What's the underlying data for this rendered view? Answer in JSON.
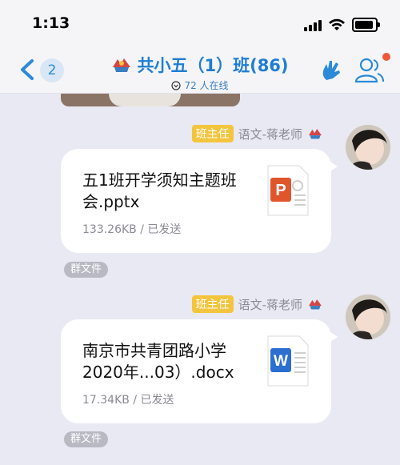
{
  "status_bar": {
    "time": "1:13"
  },
  "header": {
    "back_count": "2",
    "title": "共小五（1）班(86)",
    "online_text": "72 人在线"
  },
  "messages": [
    {
      "role_badge": "班主任",
      "sender": "语文-蒋老师",
      "file_name": "五1班开学须知主题班会.pptx",
      "file_meta": "133.26KB / 已发送",
      "file_type": "pptx",
      "file_icon": "powerpoint-icon",
      "tag": "群文件"
    },
    {
      "role_badge": "班主任",
      "sender": "语文-蒋老师",
      "file_name": "南京市共青团路小学2020年...03）.docx",
      "file_meta": "17.34KB / 已发送",
      "file_type": "docx",
      "file_icon": "word-icon",
      "tag": "群文件"
    }
  ],
  "colors": {
    "accent": "#1f7ed3",
    "ppt": "#e0562c",
    "word": "#2b6fd0",
    "badge": "#f3c53f",
    "background": "#e9e9f3"
  }
}
